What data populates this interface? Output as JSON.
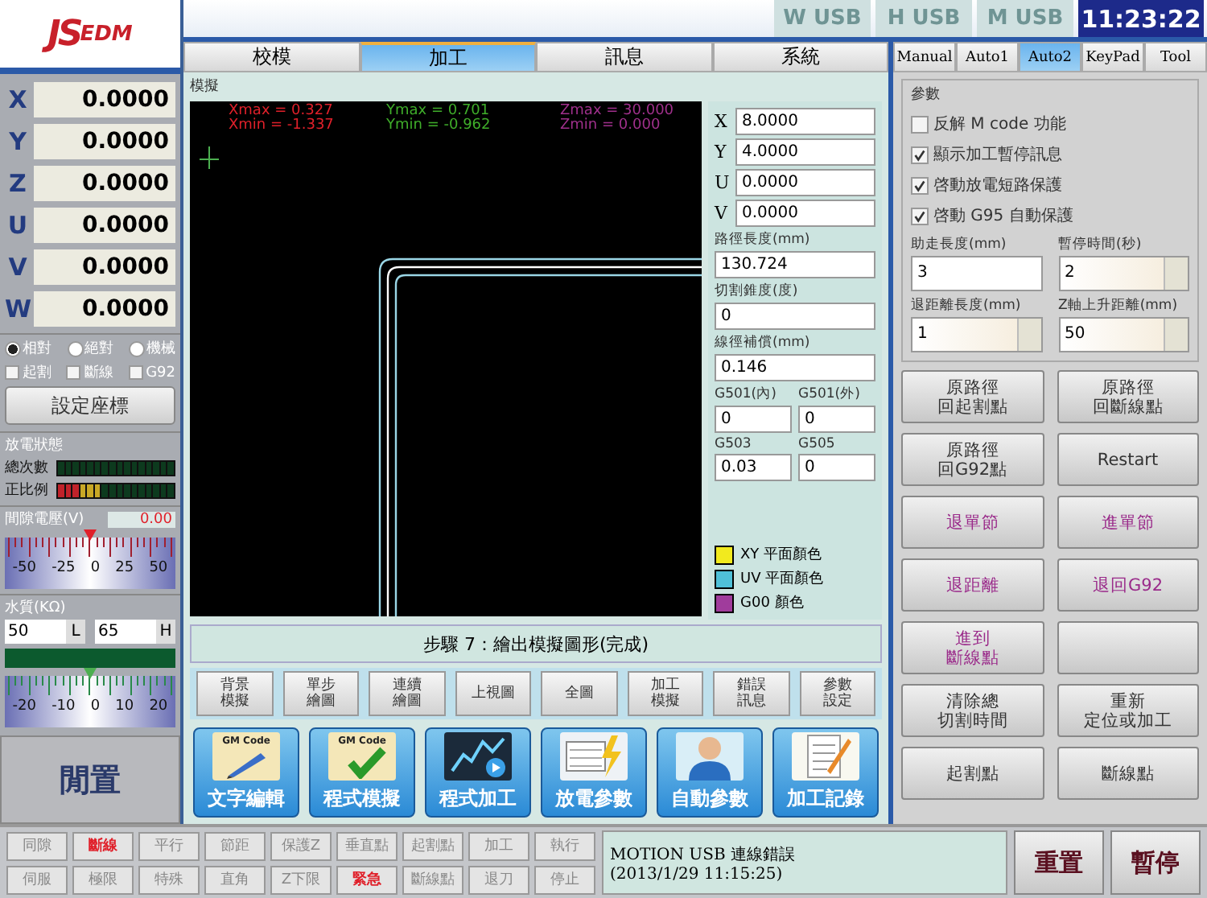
{
  "logo": {
    "parts": [
      "JS",
      "EDM"
    ]
  },
  "axes": [
    {
      "axis": "X",
      "value": "0.0000"
    },
    {
      "axis": "Y",
      "value": "0.0000"
    },
    {
      "axis": "Z",
      "value": "0.0000"
    },
    {
      "axis": "U",
      "value": "0.0000"
    },
    {
      "axis": "V",
      "value": "0.0000"
    },
    {
      "axis": "W",
      "value": "0.0000"
    }
  ],
  "coord_modes": [
    {
      "label": "相對",
      "selected": true
    },
    {
      "label": "絕對",
      "selected": false
    },
    {
      "label": "機械",
      "selected": false
    }
  ],
  "coord_options": [
    {
      "label": "起割",
      "checked": false
    },
    {
      "label": "斷線",
      "checked": false
    },
    {
      "label": "G92",
      "checked": false
    }
  ],
  "set_coord_button": "設定座標",
  "discharge": {
    "title": "放電狀態",
    "meters": [
      {
        "label": "總次數",
        "level": 0
      },
      {
        "label": "正比例",
        "level": 0.375
      }
    ]
  },
  "gap_voltage": {
    "title": "間隙電壓(V)",
    "reading": "0.00",
    "level": 0.5,
    "scale": [
      "-50",
      "-25",
      "0",
      "25",
      "50"
    ]
  },
  "water": {
    "title": "水質(KΩ)",
    "low": "50",
    "low_label": "L",
    "high": "65",
    "high_label": "H",
    "level": 0.5,
    "scale": [
      "-20",
      "-10",
      "0",
      "10",
      "20"
    ]
  },
  "idle_button": "閒置",
  "usb_indicators": [
    {
      "label": "W USB",
      "on": false
    },
    {
      "label": "H USB",
      "on": false
    },
    {
      "label": "M USB",
      "on": false
    }
  ],
  "clock": "11:23:22",
  "tabs": [
    {
      "label": "校模",
      "selected": false
    },
    {
      "label": "加工",
      "selected": true
    },
    {
      "label": "訊息",
      "selected": false
    },
    {
      "label": "系統",
      "selected": false
    }
  ],
  "simulation": {
    "title": "模擬",
    "stats": [
      {
        "text": "Xmax = 0.327",
        "color": "#e0202a"
      },
      {
        "text": "Ymax = 0.701",
        "color": "#3fae2a"
      },
      {
        "text": "Zmax = 30.000",
        "color": "#a0308c"
      },
      {
        "text": "Xmin = -1.337",
        "color": "#e0202a"
      },
      {
        "text": "Ymin = -0.962",
        "color": "#3fae2a"
      },
      {
        "text": "Zmin = 0.000",
        "color": "#a0308c"
      }
    ],
    "coords": [
      {
        "axis": "X",
        "value": "8.0000"
      },
      {
        "axis": "Y",
        "value": "4.0000"
      },
      {
        "axis": "U",
        "value": "0.0000"
      },
      {
        "axis": "V",
        "value": "0.0000"
      }
    ],
    "fields": [
      {
        "label": "路徑長度(mm)",
        "value": "130.724"
      },
      {
        "label": "切割錐度(度)",
        "value": "0"
      },
      {
        "label": "線徑補償(mm)",
        "value": "0.146"
      }
    ],
    "pair_fields": [
      {
        "label": "G501(內)",
        "value": "0"
      },
      {
        "label": "G501(外)",
        "value": "0"
      },
      {
        "label": "G503",
        "value": "0.03"
      },
      {
        "label": "G505",
        "value": "0"
      }
    ],
    "legend": [
      {
        "label": "XY 平面顏色",
        "color": "#f2ea1e"
      },
      {
        "label": "UV 平面顏色",
        "color": "#4fc0d8"
      },
      {
        "label": "G00 顏色",
        "color": "#a03c9c"
      }
    ],
    "step": "步驟 7：繪出模擬圖形(完成)"
  },
  "tool_buttons": [
    [
      "背景",
      "模擬"
    ],
    [
      "單步",
      "繪圖"
    ],
    [
      "連續",
      "繪圖"
    ],
    [
      "上視圖"
    ],
    [
      "全圖"
    ],
    [
      "加工",
      "模擬"
    ],
    [
      "錯誤",
      "訊息"
    ],
    [
      "參數",
      "設定"
    ]
  ],
  "big_buttons": [
    {
      "label": "文字編輯",
      "kind": "edit",
      "caption": "GM Code"
    },
    {
      "label": "程式模擬",
      "kind": "check",
      "caption": "GM Code"
    },
    {
      "label": "程式加工",
      "kind": "chart"
    },
    {
      "label": "放電參數",
      "kind": "power"
    },
    {
      "label": "自動參數",
      "kind": "person"
    },
    {
      "label": "加工記錄",
      "kind": "log"
    }
  ],
  "side_tabs": [
    {
      "label": "Manual",
      "selected": false
    },
    {
      "label": "Auto1",
      "selected": false
    },
    {
      "label": "Auto2",
      "selected": true
    },
    {
      "label": "KeyPad",
      "selected": false
    },
    {
      "label": "Tool",
      "selected": false
    }
  ],
  "params": {
    "title": "參數",
    "checks": [
      {
        "label": "反解 M code 功能",
        "checked": false
      },
      {
        "label": "顯示加工暫停訊息",
        "checked": true
      },
      {
        "label": "啓動放電短路保護",
        "checked": true
      },
      {
        "label": "啓動 G95 自動保護",
        "checked": true
      }
    ],
    "fields": [
      {
        "label": "助走長度(mm)",
        "value": "3",
        "kind": "text"
      },
      {
        "label": "暫停時間(秒)",
        "value": "2",
        "kind": "spin"
      },
      {
        "label": "退距離長度(mm)",
        "value": "1",
        "kind": "spin"
      },
      {
        "label": "Z軸上升距離(mm)",
        "value": "50",
        "kind": "spin"
      }
    ]
  },
  "side_buttons": [
    {
      "lines": [
        "原路徑",
        "回起割點"
      ],
      "kind": "normal"
    },
    {
      "lines": [
        "原路徑",
        "回斷線點"
      ],
      "kind": "normal"
    },
    {
      "lines": [
        "原路徑",
        "回G92點"
      ],
      "kind": "normal"
    },
    {
      "lines": [
        "Restart"
      ],
      "kind": "normal"
    },
    {
      "lines": [
        "退單節"
      ],
      "kind": "move"
    },
    {
      "lines": [
        "進單節"
      ],
      "kind": "move"
    },
    {
      "lines": [
        "退距離"
      ],
      "kind": "move"
    },
    {
      "lines": [
        "退回G92"
      ],
      "kind": "move"
    },
    {
      "lines": [
        "進到",
        "斷線點"
      ],
      "kind": "move"
    },
    {
      "kind": "blank"
    },
    {
      "lines": [
        "清除總",
        "切割時間"
      ],
      "kind": "normal"
    },
    {
      "lines": [
        "重新",
        "定位或加工"
      ],
      "kind": "normal"
    },
    {
      "lines": [
        "起割點"
      ],
      "kind": "normal"
    },
    {
      "lines": [
        "斷線點"
      ],
      "kind": "normal"
    }
  ],
  "status_flags": [
    {
      "label": "同隙",
      "on": false
    },
    {
      "label": "斷線",
      "on": true
    },
    {
      "label": "平行",
      "on": false
    },
    {
      "label": "節距",
      "on": false
    },
    {
      "label": "保護Z",
      "on": false
    },
    {
      "label": "垂直點",
      "on": false
    },
    {
      "label": "起割點",
      "on": false
    },
    {
      "label": "加工",
      "on": false
    },
    {
      "label": "執行",
      "on": false
    },
    {
      "label": "伺服",
      "on": false
    },
    {
      "label": "極限",
      "on": false
    },
    {
      "label": "特殊",
      "on": false
    },
    {
      "label": "直角",
      "on": false
    },
    {
      "label": "Z下限",
      "on": false
    },
    {
      "label": "緊急",
      "on": true
    },
    {
      "label": "斷線點",
      "on": false
    },
    {
      "label": "退刀",
      "on": false
    },
    {
      "label": "停止",
      "on": false
    }
  ],
  "message": [
    "MOTION USB 連線錯誤",
    "(2013/1/29  11:15:25)"
  ],
  "bottom_buttons": [
    "重置",
    "暫停"
  ]
}
